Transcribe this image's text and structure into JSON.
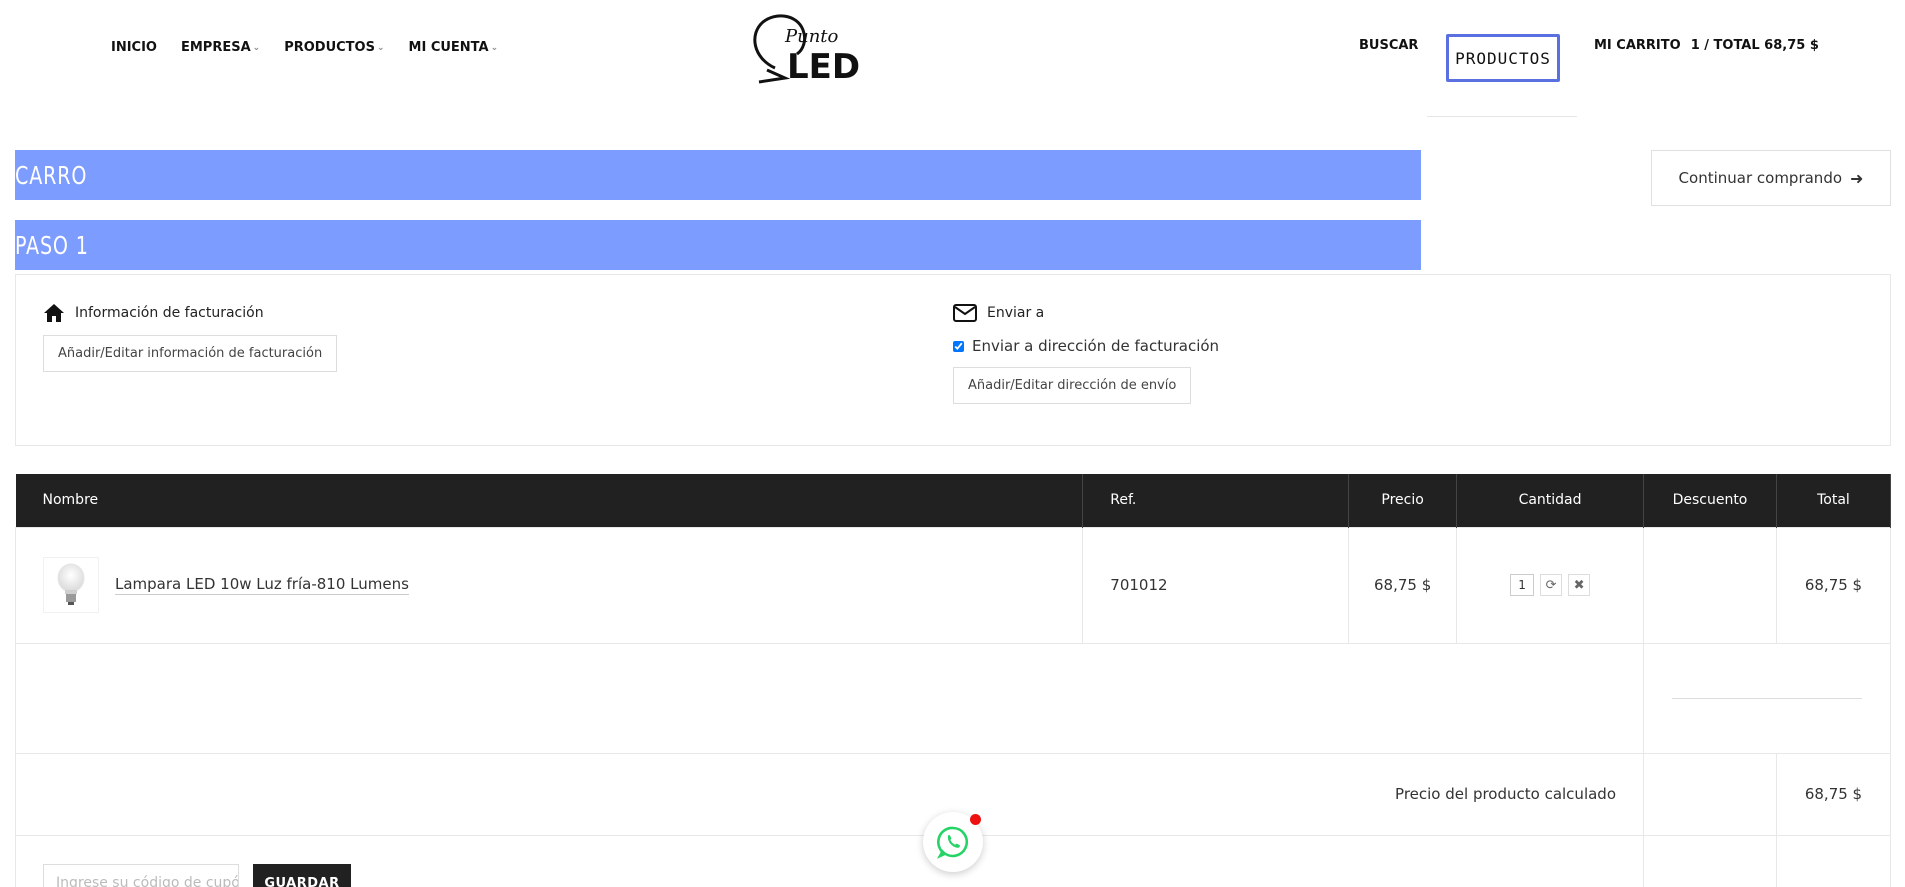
{
  "nav": {
    "inicio": "INICIO",
    "empresa": "EMPRESA",
    "productos": "PRODUCTOS",
    "mi_cuenta": "MI CUENTA",
    "buscar": "BUSCAR",
    "productos_banner": "PRODUCTOS",
    "mi_carrito": "MI CARRITO",
    "cart_total": "1 / TOTAL 68,75 $"
  },
  "logo": {
    "script": "Punto",
    "bold": "LED"
  },
  "headings": {
    "carro": "CARRO",
    "paso": "PASO 1"
  },
  "continue_button": "Continuar comprando",
  "billing": {
    "title": "Información de facturación",
    "button": "Añadir/Editar información de facturación"
  },
  "shipping": {
    "title": "Enviar a",
    "checkbox_label": "Enviar a dirección de facturación",
    "checkbox_checked": true,
    "button": "Añadir/Editar dirección de envío"
  },
  "table": {
    "headers": [
      "Nombre",
      "Ref.",
      "Precio",
      "Cantidad",
      "Descuento",
      "Total"
    ],
    "rows": [
      {
        "name": "Lampara LED 10w Luz fría-810 Lumens",
        "ref": "701012",
        "price": "68,75 $",
        "quantity": "1",
        "discount": "",
        "total": "68,75 $"
      }
    ],
    "subtotal_label": "Precio del producto calculado",
    "subtotal_value": "68,75 $"
  },
  "coupon": {
    "placeholder": "Ingrese su código de cupón",
    "button": "GUARDAR"
  },
  "colors": {
    "heading_bar": "#7d9cff",
    "table_header": "#212121",
    "productos_border": "#5a6fe0",
    "whatsapp": "#25d366",
    "notification_dot": "#ee1111"
  },
  "icons": [
    "home-icon",
    "envelope-icon",
    "refresh-icon",
    "close-icon",
    "arrow-right-icon",
    "whatsapp-icon",
    "bulb-icon"
  ]
}
